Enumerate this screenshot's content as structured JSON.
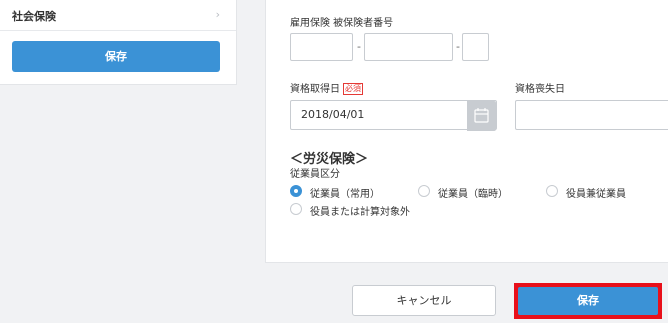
{
  "sidebar": {
    "item_label": "社会保険",
    "chevron": "›",
    "save_label": "保存"
  },
  "form": {
    "employment_insurance_label": "雇用保険 被保険者番号",
    "dash": "-",
    "acquisition_date_label": "資格取得日",
    "required_badge": "必須",
    "acquisition_date_value": "2018/04/01",
    "loss_date_label": "資格喪失日",
    "workers_comp_title": "＜労災保険＞",
    "employee_category_label": "従業員区分",
    "options": [
      {
        "label": "従業員（常用）",
        "selected": true
      },
      {
        "label": "従業員（臨時）",
        "selected": false
      },
      {
        "label": "役員兼従業員",
        "selected": false
      },
      {
        "label": "役員または計算対象外",
        "selected": false
      }
    ]
  },
  "footer": {
    "cancel_label": "キャンセル",
    "save_label": "保存"
  },
  "colors": {
    "accent": "#3b92d6",
    "highlight": "#e8101a",
    "required": "#e53935"
  },
  "icons": {
    "calendar": "calendar-icon",
    "chevron": "chevron-right-icon"
  }
}
